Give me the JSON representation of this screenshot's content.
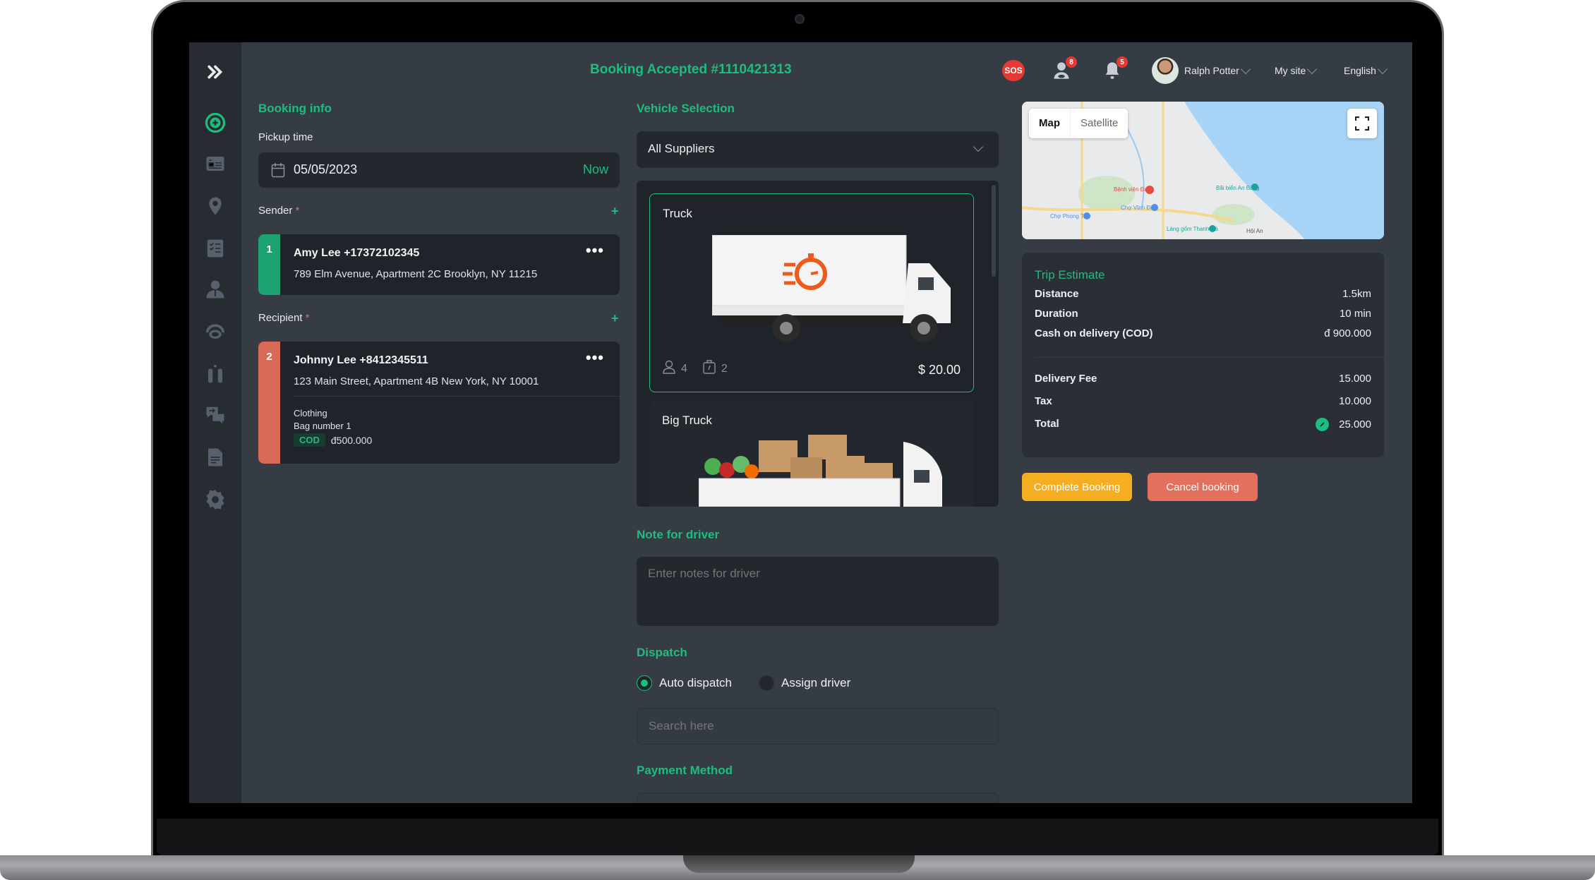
{
  "header": {
    "title": "Booking Accepted #1110421313",
    "sos_label": "SOS",
    "drivers_badge": "8",
    "notifications_badge": "5",
    "user_name": "Ralph Potter",
    "site_label": "My site",
    "language_label": "English"
  },
  "sidebar": {
    "items": [
      {
        "icon": "add-circle-icon",
        "active": true
      },
      {
        "icon": "id-card-icon"
      },
      {
        "icon": "map-pin-icon"
      },
      {
        "icon": "checklist-icon"
      },
      {
        "icon": "user-icon"
      },
      {
        "icon": "support-icon"
      },
      {
        "icon": "drivers-icon"
      },
      {
        "icon": "chat-icon"
      },
      {
        "icon": "document-icon"
      },
      {
        "icon": "settings-icon"
      }
    ]
  },
  "booking_info": {
    "title": "Booking info",
    "pickup_label": "Pickup time",
    "pickup_date": "05/05/2023",
    "now_label": "Now",
    "sender_label": "Sender",
    "recipient_label": "Recipient",
    "required_mark": "*",
    "add_label": "+",
    "sender": {
      "index": "1",
      "name": "Amy Lee +17372102345",
      "address": "789 Elm Avenue, Apartment 2C Brooklyn, NY 11215"
    },
    "recipient": {
      "index": "2",
      "name": "Johnny Lee  +8412345511",
      "address": "123 Main Street, Apartment 4B New York, NY 10001",
      "item_type": "Clothing",
      "item_detail": "Bag number 1",
      "cod_tag": "COD",
      "cod_amount": "đ500.000"
    },
    "more_label": "•••"
  },
  "vehicle_selection": {
    "title": "Vehicle Selection",
    "supplier_selected": "All Suppliers",
    "vehicles": [
      {
        "name": "Truck",
        "passengers": "4",
        "luggage": "2",
        "price": "$ 20.00",
        "selected": true
      },
      {
        "name": "Big Truck",
        "selected": false
      }
    ]
  },
  "note": {
    "title": "Note for driver",
    "placeholder": "Enter notes for driver"
  },
  "dispatch": {
    "title": "Dispatch",
    "options": [
      {
        "label": "Auto dispatch",
        "checked": true
      },
      {
        "label": "Assign driver",
        "checked": false
      }
    ],
    "search_placeholder": "Search here"
  },
  "payment": {
    "title": "Payment Method"
  },
  "map": {
    "map_tab": "Map",
    "satellite_tab": "Satellite",
    "places": [
      "Bệnh viện Đa khoa Vĩnh Đức",
      "Chợ Vĩnh Điện",
      "Chợ Phong Thử",
      "Bãi biển An Bàng",
      "Làng gốm Thanh Hà",
      "Hội An"
    ]
  },
  "trip_estimate": {
    "title": "Trip Estimate",
    "rows": [
      {
        "label": "Distance",
        "value": "1.5km"
      },
      {
        "label": "Duration",
        "value": "10 min"
      },
      {
        "label": "Cash on delivery (COD)",
        "value": "đ 900.000"
      }
    ],
    "fees": [
      {
        "label": "Delivery Fee",
        "value": "15.000"
      },
      {
        "label": "Tax",
        "value": "10.000"
      },
      {
        "label": "Total",
        "value": "25.000"
      }
    ]
  },
  "actions": {
    "complete_label": "Complete Booking",
    "cancel_label": "Cancel booking"
  },
  "colors": {
    "accent": "#1fbc7f",
    "warning": "#f5ae21",
    "danger": "#e2705c"
  }
}
